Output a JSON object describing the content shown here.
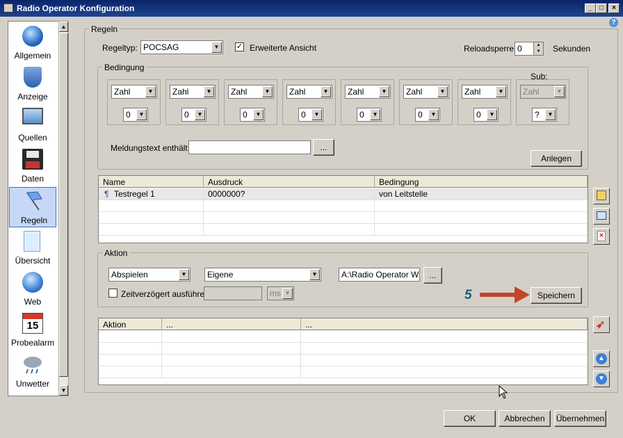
{
  "window": {
    "title": "Radio Operator Konfiguration"
  },
  "sidebar": {
    "items": [
      {
        "label": "Allgemein",
        "icon": "globe-icon"
      },
      {
        "label": "Anzeige",
        "icon": "shield-icon"
      },
      {
        "label": "Quellen",
        "icon": "monitor-icon"
      },
      {
        "label": "Daten",
        "icon": "floppy-icon"
      },
      {
        "label": "Regeln",
        "icon": "flag-icon",
        "selected": true
      },
      {
        "label": "Übersicht",
        "icon": "document-icon"
      },
      {
        "label": "Web",
        "icon": "web-globe-icon"
      },
      {
        "label": "Probealarm",
        "icon": "calendar-icon",
        "calendar_day": "15"
      },
      {
        "label": "Unwetter",
        "icon": "storm-cloud-icon"
      }
    ]
  },
  "regeln": {
    "group_title": "Regeln",
    "regeltyp_label": "Regeltyp:",
    "regeltyp_value": "POCSAG",
    "erweiterte_label": "Erweiterte Ansicht",
    "erweiterte_checked": true,
    "reload_label": "Reloadsperre:",
    "reload_value": "0",
    "reload_unit": "Sekunden"
  },
  "bedingung": {
    "group_title": "Bedingung",
    "sub_label": "Sub:",
    "boxes": [
      {
        "type": "Zahl",
        "digit": "0"
      },
      {
        "type": "Zahl",
        "digit": "0"
      },
      {
        "type": "Zahl",
        "digit": "0"
      },
      {
        "type": "Zahl",
        "digit": "0"
      },
      {
        "type": "Zahl",
        "digit": "0"
      },
      {
        "type": "Zahl",
        "digit": "0"
      },
      {
        "type": "Zahl",
        "digit": "0"
      },
      {
        "type": "Zahl",
        "digit": "?"
      }
    ],
    "meldung_label": "Meldungstext enthält:",
    "meldung_value": "",
    "browse_label": "...",
    "anlegen_label": "Anlegen"
  },
  "rules_table": {
    "headers": [
      "Name",
      "Ausdruck",
      "Bedingung"
    ],
    "rows": [
      [
        "Testregel 1",
        "0000000?",
        "von Leitstelle"
      ]
    ]
  },
  "aktion": {
    "group_title": "Aktion",
    "action_value": "Abspielen",
    "source_value": "Eigene",
    "path_value": "A:\\Radio Operator WIK",
    "browse_label": "...",
    "delay_label": "Zeitverzögert ausführen",
    "delay_checked": false,
    "delay_value": "",
    "delay_unit": "ms",
    "speichern_label": "Speichern",
    "annotation_number": "5"
  },
  "action_table": {
    "headers": [
      "Aktion",
      "...",
      "..."
    ]
  },
  "footer": {
    "ok_label": "OK",
    "cancel_label": "Abbrechen",
    "apply_label": "Übernehmen"
  },
  "colors": {
    "titlebar": "#0a246a",
    "annotation": "#1f5f7a",
    "arrow": "#c0462c",
    "selection": "#c7d8f6"
  }
}
